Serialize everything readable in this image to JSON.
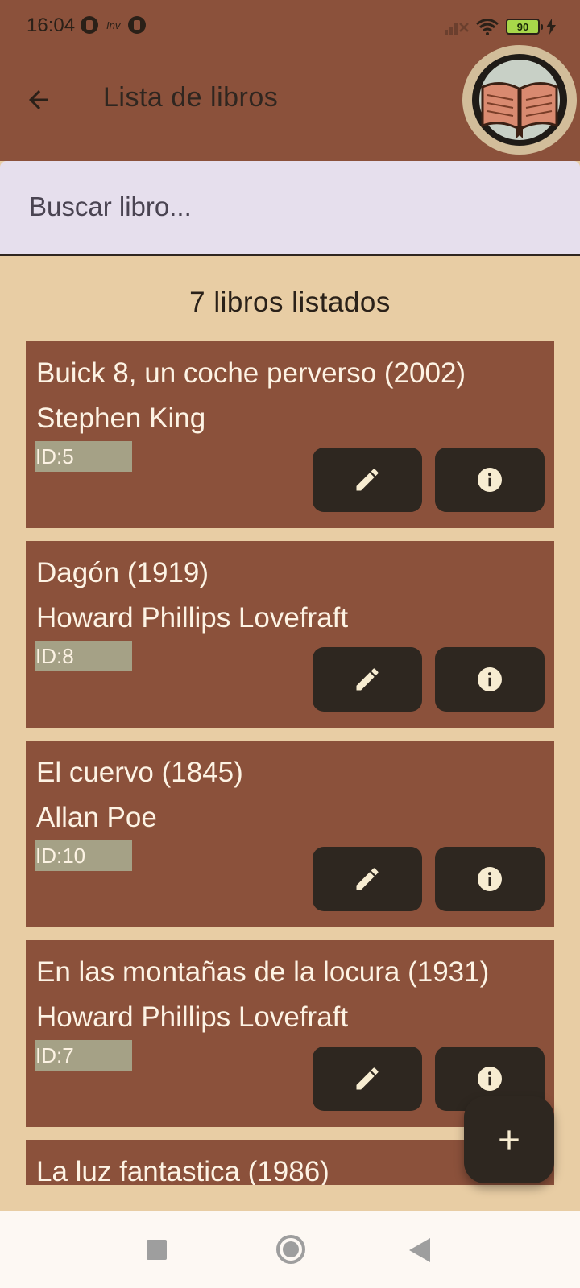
{
  "status_bar": {
    "time": "16:04",
    "mini_label": "Inv",
    "battery": "90"
  },
  "app_bar": {
    "title": "Lista de libros"
  },
  "search": {
    "placeholder": "Buscar libro..."
  },
  "list": {
    "count_label": "7 libros listados",
    "books": [
      {
        "title": "Buick 8, un coche perverso (2002)",
        "author": "Stephen King",
        "id": "ID:5"
      },
      {
        "title": "Dagón (1919)",
        "author": "Howard Phillips  Lovefraft",
        "id": "ID:8"
      },
      {
        "title": "El cuervo (1845)",
        "author": "Allan Poe",
        "id": "ID:10"
      },
      {
        "title": "En las montañas de la locura  (1931)",
        "author": "Howard Phillips  Lovefraft",
        "id": "ID:7"
      },
      {
        "title": "La luz fantastica (1986)",
        "author": "",
        "id": ""
      }
    ]
  },
  "icons": {
    "back": "arrow-left-icon",
    "edit": "pencil-icon",
    "info": "info-icon",
    "add": "plus-icon",
    "logo": "open-book-icon"
  },
  "colors": {
    "app_bar": "#8b513b",
    "background": "#e8cda4",
    "card": "#8b513b",
    "button": "#2e2720",
    "id_badge": "#a5a186",
    "search_bg": "#e6dfed"
  }
}
